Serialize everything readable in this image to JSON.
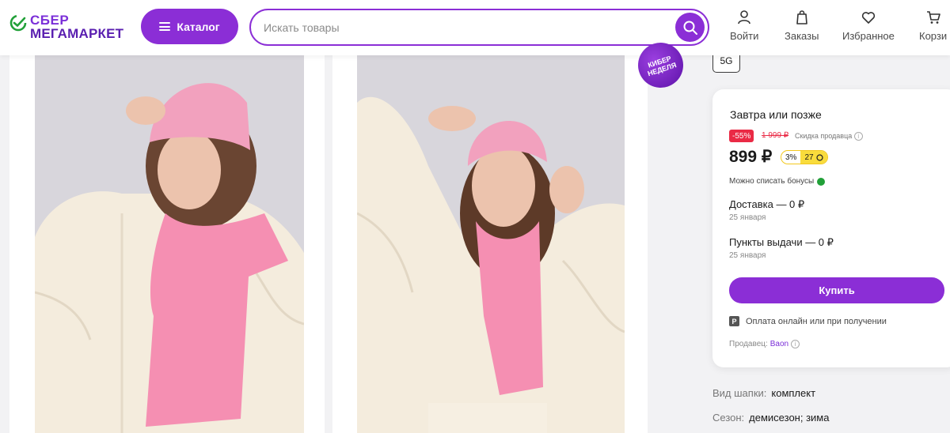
{
  "header": {
    "logo_line1": "СБЕР",
    "logo_line2": "МЕГАМАРКЕТ",
    "catalog_label": "Каталог",
    "search_placeholder": "Искать товары",
    "nav": [
      {
        "label": "Войти",
        "icon": "user-icon"
      },
      {
        "label": "Заказы",
        "icon": "bag-icon"
      },
      {
        "label": "Избранное",
        "icon": "heart-icon"
      },
      {
        "label": "Корзи",
        "icon": "cart-icon"
      }
    ]
  },
  "promo_badge": "КИБЕР НЕДЕЛЯ",
  "memory_option": "5G",
  "offer": {
    "delivery_title": "Завтра или позже",
    "discount": "-55%",
    "old_price": "1 999 ₽",
    "seller_discount": "Скидка продавца",
    "price": "899 ₽",
    "bonus_percent": "3%",
    "bonus_points": "27",
    "bonus_note": "Можно списать бонусы",
    "delivery_label": "Доставка — 0 ₽",
    "delivery_date": "25 января",
    "pickup_label": "Пункты выдачи — 0 ₽",
    "pickup_date": "25 января",
    "buy_label": "Купить",
    "payment_note": "Оплата онлайн или при получении",
    "seller_label": "Продавец:",
    "seller_name": "Baon"
  },
  "specs": [
    {
      "name": "Вид шапки:",
      "value": "комплект"
    },
    {
      "name": "Сезон:",
      "value": "демисезон; зима"
    }
  ],
  "colors": {
    "accent": "#8b2ed6",
    "discount": "#ea2a45",
    "bonus": "#f9dc3c",
    "sber_green": "#21a038"
  }
}
